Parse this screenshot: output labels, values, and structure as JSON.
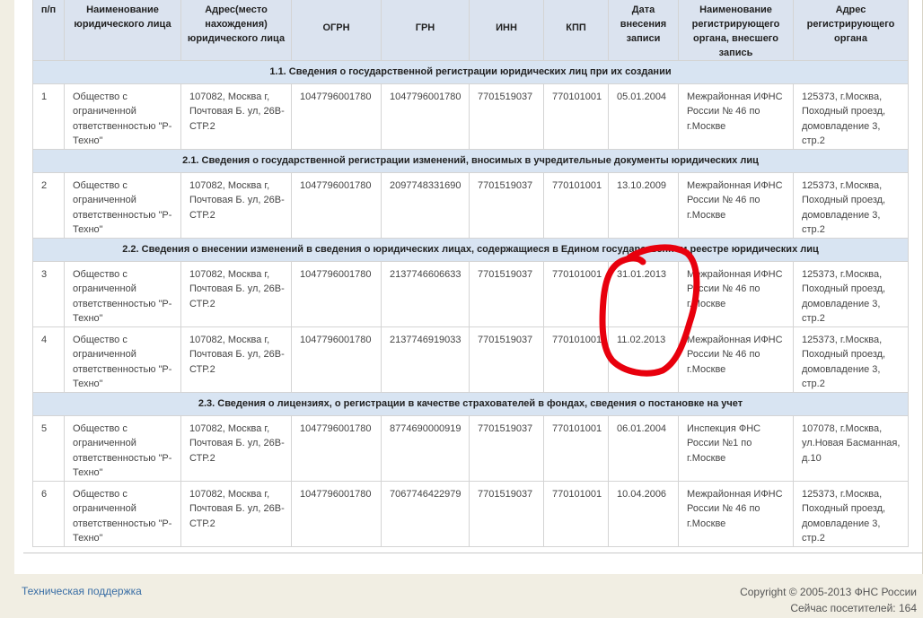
{
  "table": {
    "headers": [
      "п/п",
      "Наименование юридического лица",
      "Адрес(место нахождения) юридического лица",
      "ОГРН",
      "ГРН",
      "ИНН",
      "КПП",
      "Дата внесения записи",
      "Наименование регистрирующего органа, внесшего запись",
      "Адрес регистрирующего органа"
    ],
    "sections": [
      {
        "title": "1.1. Сведения о государственной регистрации юридических лиц при их создании",
        "rows": [
          {
            "num": "1",
            "name": "Общество с ограниченной ответственностью \"Р-Техно\"",
            "address": "107082, Москва г, Почтовая Б. ул, 26В-СТР.2",
            "ogrn": "1047796001780",
            "grn": "1047796001780",
            "inn": "7701519037",
            "kpp": "770101001",
            "date": "05.01.2004",
            "organ": "Межрайонная ИФНС России № 46 по г.Москве",
            "organ_address": "125373, г.Москва, Походный проезд, домовладение 3, стр.2"
          }
        ]
      },
      {
        "title": "2.1. Сведения о государственной регистрации изменений, вносимых в учредительные документы юридических лиц",
        "rows": [
          {
            "num": "2",
            "name": "Общество с ограниченной ответственностью \"Р-Техно\"",
            "address": "107082, Москва г, Почтовая Б. ул, 26В-СТР.2",
            "ogrn": "1047796001780",
            "grn": "2097748331690",
            "inn": "7701519037",
            "kpp": "770101001",
            "date": "13.10.2009",
            "organ": "Межрайонная ИФНС России № 46 по г.Москве",
            "organ_address": "125373, г.Москва, Походный проезд, домовладение 3, стр.2"
          }
        ]
      },
      {
        "title": "2.2. Сведения о внесении изменений в сведения о юридических лицах, содержащиеся в Едином государственном реестре юридических лиц",
        "rows": [
          {
            "num": "3",
            "name": "Общество с ограниченной ответственностью \"Р-Техно\"",
            "address": "107082, Москва г, Почтовая Б. ул, 26В-СТР.2",
            "ogrn": "1047796001780",
            "grn": "2137746606633",
            "inn": "7701519037",
            "kpp": "770101001",
            "date": "31.01.2013",
            "organ": "Межрайонная ИФНС России № 46 по г.Москве",
            "organ_address": "125373, г.Москва, Походный проезд, домовладение 3, стр.2"
          },
          {
            "num": "4",
            "name": "Общество с ограниченной ответственностью \"Р-Техно\"",
            "address": "107082, Москва г, Почтовая Б. ул, 26В-СТР.2",
            "ogrn": "1047796001780",
            "grn": "2137746919033",
            "inn": "7701519037",
            "kpp": "770101001",
            "date": "11.02.2013",
            "organ": "Межрайонная ИФНС России № 46 по г.Москве",
            "organ_address": "125373, г.Москва, Походный проезд, домовладение 3, стр.2"
          }
        ]
      },
      {
        "title": "2.3. Сведения о лицензиях, о регистрации в качестве страхователей в фондах, сведения о постановке на учет",
        "rows": [
          {
            "num": "5",
            "name": "Общество с ограниченной ответственностью \"Р-Техно\"",
            "address": "107082, Москва г, Почтовая Б. ул, 26В-СТР.2",
            "ogrn": "1047796001780",
            "grn": "8774690000919",
            "inn": "7701519037",
            "kpp": "770101001",
            "date": "06.01.2004",
            "organ": "Инспекция ФНС России №1 по г.Москве",
            "organ_address": "107078, г.Москва, ул.Новая Басманная, д.10"
          },
          {
            "num": "6",
            "name": "Общество с ограниченной ответственностью \"Р-Техно\"",
            "address": "107082, Москва г, Почтовая Б. ул, 26В-СТР.2",
            "ogrn": "1047796001780",
            "grn": "7067746422979",
            "inn": "7701519037",
            "kpp": "770101001",
            "date": "10.04.2006",
            "organ": "Межрайонная ИФНС России № 46 по г.Москве",
            "organ_address": "125373, г.Москва, Походный проезд, домовладение 3, стр.2"
          }
        ]
      }
    ]
  },
  "footer": {
    "support_link": "Техническая поддержка",
    "copyright": "Copyright © 2005-2013 ФНС России",
    "visitors": "Сейчас посетителей: 164"
  },
  "annotation_color": "#e8000d"
}
